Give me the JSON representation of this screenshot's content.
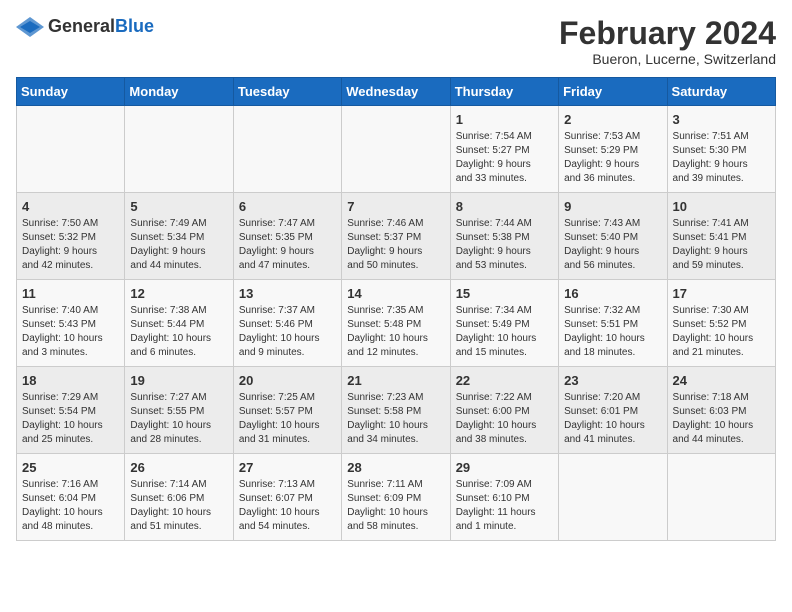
{
  "header": {
    "logo_general": "General",
    "logo_blue": "Blue",
    "title": "February 2024",
    "subtitle": "Bueron, Lucerne, Switzerland"
  },
  "days_of_week": [
    "Sunday",
    "Monday",
    "Tuesday",
    "Wednesday",
    "Thursday",
    "Friday",
    "Saturday"
  ],
  "weeks": [
    [
      {
        "day": "",
        "info": ""
      },
      {
        "day": "",
        "info": ""
      },
      {
        "day": "",
        "info": ""
      },
      {
        "day": "",
        "info": ""
      },
      {
        "day": "1",
        "info": "Sunrise: 7:54 AM\nSunset: 5:27 PM\nDaylight: 9 hours\nand 33 minutes."
      },
      {
        "day": "2",
        "info": "Sunrise: 7:53 AM\nSunset: 5:29 PM\nDaylight: 9 hours\nand 36 minutes."
      },
      {
        "day": "3",
        "info": "Sunrise: 7:51 AM\nSunset: 5:30 PM\nDaylight: 9 hours\nand 39 minutes."
      }
    ],
    [
      {
        "day": "4",
        "info": "Sunrise: 7:50 AM\nSunset: 5:32 PM\nDaylight: 9 hours\nand 42 minutes."
      },
      {
        "day": "5",
        "info": "Sunrise: 7:49 AM\nSunset: 5:34 PM\nDaylight: 9 hours\nand 44 minutes."
      },
      {
        "day": "6",
        "info": "Sunrise: 7:47 AM\nSunset: 5:35 PM\nDaylight: 9 hours\nand 47 minutes."
      },
      {
        "day": "7",
        "info": "Sunrise: 7:46 AM\nSunset: 5:37 PM\nDaylight: 9 hours\nand 50 minutes."
      },
      {
        "day": "8",
        "info": "Sunrise: 7:44 AM\nSunset: 5:38 PM\nDaylight: 9 hours\nand 53 minutes."
      },
      {
        "day": "9",
        "info": "Sunrise: 7:43 AM\nSunset: 5:40 PM\nDaylight: 9 hours\nand 56 minutes."
      },
      {
        "day": "10",
        "info": "Sunrise: 7:41 AM\nSunset: 5:41 PM\nDaylight: 9 hours\nand 59 minutes."
      }
    ],
    [
      {
        "day": "11",
        "info": "Sunrise: 7:40 AM\nSunset: 5:43 PM\nDaylight: 10 hours\nand 3 minutes."
      },
      {
        "day": "12",
        "info": "Sunrise: 7:38 AM\nSunset: 5:44 PM\nDaylight: 10 hours\nand 6 minutes."
      },
      {
        "day": "13",
        "info": "Sunrise: 7:37 AM\nSunset: 5:46 PM\nDaylight: 10 hours\nand 9 minutes."
      },
      {
        "day": "14",
        "info": "Sunrise: 7:35 AM\nSunset: 5:48 PM\nDaylight: 10 hours\nand 12 minutes."
      },
      {
        "day": "15",
        "info": "Sunrise: 7:34 AM\nSunset: 5:49 PM\nDaylight: 10 hours\nand 15 minutes."
      },
      {
        "day": "16",
        "info": "Sunrise: 7:32 AM\nSunset: 5:51 PM\nDaylight: 10 hours\nand 18 minutes."
      },
      {
        "day": "17",
        "info": "Sunrise: 7:30 AM\nSunset: 5:52 PM\nDaylight: 10 hours\nand 21 minutes."
      }
    ],
    [
      {
        "day": "18",
        "info": "Sunrise: 7:29 AM\nSunset: 5:54 PM\nDaylight: 10 hours\nand 25 minutes."
      },
      {
        "day": "19",
        "info": "Sunrise: 7:27 AM\nSunset: 5:55 PM\nDaylight: 10 hours\nand 28 minutes."
      },
      {
        "day": "20",
        "info": "Sunrise: 7:25 AM\nSunset: 5:57 PM\nDaylight: 10 hours\nand 31 minutes."
      },
      {
        "day": "21",
        "info": "Sunrise: 7:23 AM\nSunset: 5:58 PM\nDaylight: 10 hours\nand 34 minutes."
      },
      {
        "day": "22",
        "info": "Sunrise: 7:22 AM\nSunset: 6:00 PM\nDaylight: 10 hours\nand 38 minutes."
      },
      {
        "day": "23",
        "info": "Sunrise: 7:20 AM\nSunset: 6:01 PM\nDaylight: 10 hours\nand 41 minutes."
      },
      {
        "day": "24",
        "info": "Sunrise: 7:18 AM\nSunset: 6:03 PM\nDaylight: 10 hours\nand 44 minutes."
      }
    ],
    [
      {
        "day": "25",
        "info": "Sunrise: 7:16 AM\nSunset: 6:04 PM\nDaylight: 10 hours\nand 48 minutes."
      },
      {
        "day": "26",
        "info": "Sunrise: 7:14 AM\nSunset: 6:06 PM\nDaylight: 10 hours\nand 51 minutes."
      },
      {
        "day": "27",
        "info": "Sunrise: 7:13 AM\nSunset: 6:07 PM\nDaylight: 10 hours\nand 54 minutes."
      },
      {
        "day": "28",
        "info": "Sunrise: 7:11 AM\nSunset: 6:09 PM\nDaylight: 10 hours\nand 58 minutes."
      },
      {
        "day": "29",
        "info": "Sunrise: 7:09 AM\nSunset: 6:10 PM\nDaylight: 11 hours\nand 1 minute."
      },
      {
        "day": "",
        "info": ""
      },
      {
        "day": "",
        "info": ""
      }
    ]
  ]
}
